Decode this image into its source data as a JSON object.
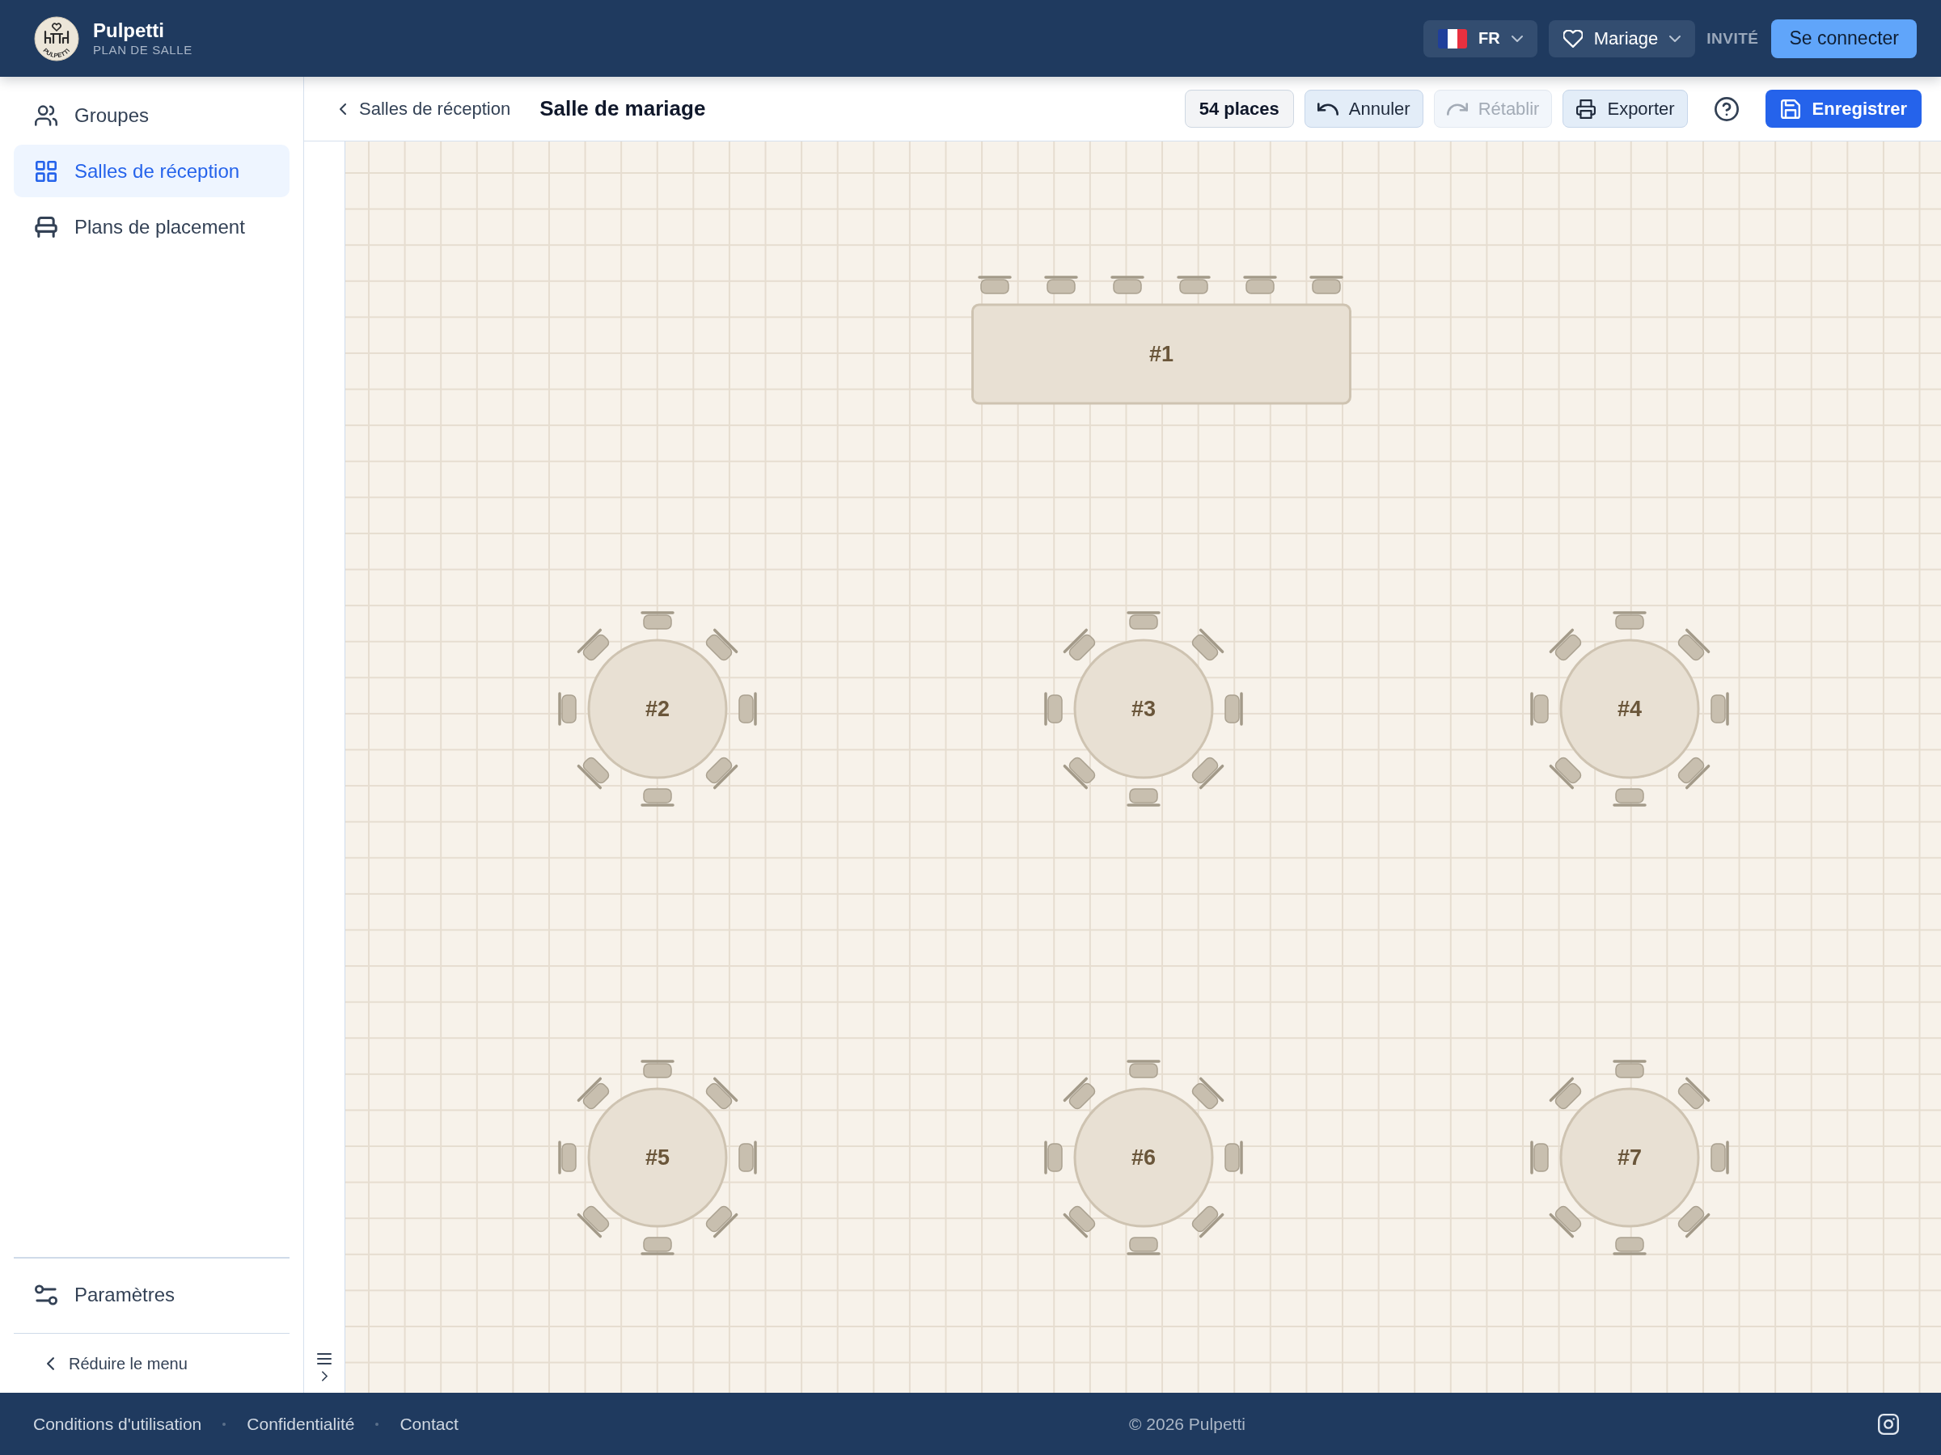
{
  "header": {
    "logo_text": "PULPETTI",
    "brand": "Pulpetti",
    "subtitle": "PLAN DE SALLE",
    "language": "FR",
    "event": "Mariage",
    "role": "INVITÉ",
    "login_button": "Se connecter"
  },
  "sidebar": {
    "items": [
      {
        "label": "Groupes",
        "selected": false
      },
      {
        "label": "Salles de réception",
        "selected": true
      },
      {
        "label": "Plans de placement",
        "selected": false
      }
    ],
    "settings": "Paramètres",
    "collapse": "Réduire le menu"
  },
  "toolbar": {
    "back_link": "Salles de réception",
    "title": "Salle de mariage",
    "capacity": "54 places",
    "buttons": [
      {
        "label": "Annuler",
        "disabled": false
      },
      {
        "label": "Rétablir",
        "disabled": true
      },
      {
        "label": "Exporter",
        "disabled": false
      }
    ],
    "save_button": "Enregistrer"
  },
  "floor_plan": {
    "tables": [
      {
        "kind": "long",
        "label": "#1"
      },
      {
        "kind": "round",
        "label": "#2"
      },
      {
        "kind": "round",
        "label": "#3"
      },
      {
        "kind": "round",
        "label": "#4"
      },
      {
        "kind": "round",
        "label": "#5"
      },
      {
        "kind": "round",
        "label": "#6"
      },
      {
        "kind": "round",
        "label": "#7"
      }
    ]
  },
  "footer": {
    "links": [
      "Conditions d'utilisation",
      "Confidentialité",
      "Contact"
    ],
    "copyright": "© 2026 Pulpetti"
  }
}
